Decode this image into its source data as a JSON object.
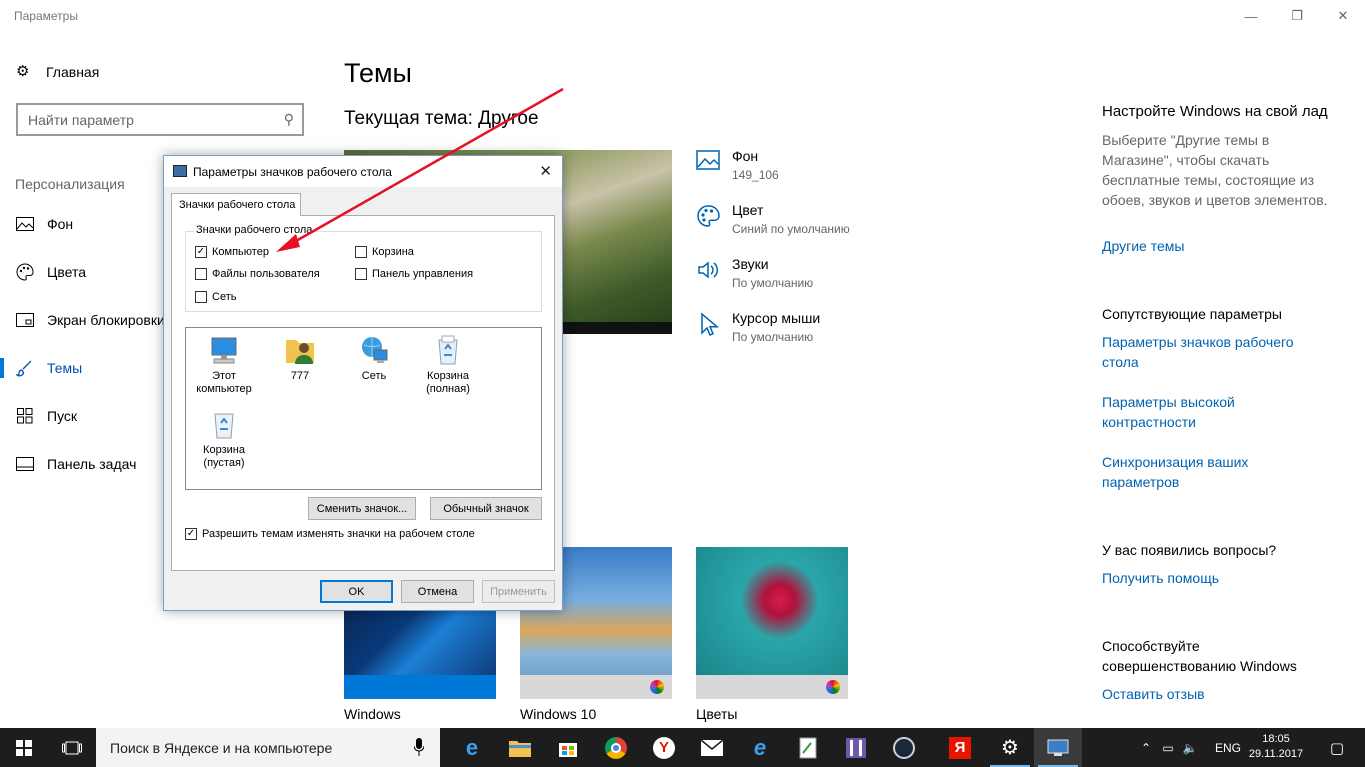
{
  "window": {
    "title": "Параметры"
  },
  "sidebar": {
    "home": "Главная",
    "search_placeholder": "Найти параметр",
    "section": "Персонализация",
    "items": [
      {
        "label": "Фон",
        "icon": "picture-icon"
      },
      {
        "label": "Цвета",
        "icon": "palette-icon"
      },
      {
        "label": "Экран блокировки",
        "icon": "lock-screen-icon"
      },
      {
        "label": "Темы",
        "icon": "brush-icon",
        "active": true
      },
      {
        "label": "Пуск",
        "icon": "start-icon"
      },
      {
        "label": "Панель задач",
        "icon": "taskbar-icon"
      }
    ]
  },
  "main": {
    "title": "Темы",
    "current_theme": "Текущая тема: Другое",
    "props": [
      {
        "title": "Фон",
        "value": "149_106",
        "icon": "picture-icon"
      },
      {
        "title": "Цвет",
        "value": "Синий по умолчанию",
        "icon": "palette-icon"
      },
      {
        "title": "Звуки",
        "value": "По умолчанию",
        "icon": "speaker-icon"
      },
      {
        "title": "Курсор мыши",
        "value": "По умолчанию",
        "icon": "cursor-icon"
      }
    ],
    "themes": [
      {
        "name": "Windows"
      },
      {
        "name": "Windows 10"
      },
      {
        "name": "Цветы"
      }
    ]
  },
  "right": {
    "h1": "Настройте Windows на свой лад",
    "p1": "Выберите \"Другие темы в Магазине\", чтобы скачать бесплатные темы, состоящие из обоев, звуков и цветов элементов.",
    "link1": "Другие темы",
    "h2": "Сопутствующие параметры",
    "link2": "Параметры значков рабочего стола",
    "link3": "Параметры высокой контрастности",
    "link4": "Синхронизация ваших параметров",
    "h3": "У вас появились вопросы?",
    "link5": "Получить помощь",
    "h4": "Способствуйте совершенствованию Windows",
    "link6": "Оставить отзыв"
  },
  "dialog": {
    "title": "Параметры значков рабочего стола",
    "tab": "Значки рабочего стола",
    "group": "Значки рабочего стола",
    "checkboxes": [
      {
        "label": "Компьютер",
        "checked": true
      },
      {
        "label": "Корзина",
        "checked": false
      },
      {
        "label": "Файлы пользователя",
        "checked": false
      },
      {
        "label": "Панель управления",
        "checked": false
      },
      {
        "label": "Сеть",
        "checked": false
      }
    ],
    "icons": [
      {
        "label": "Этот компьютер",
        "icon": "computer-icon"
      },
      {
        "label": "777",
        "icon": "user-folder-icon"
      },
      {
        "label": "Сеть",
        "icon": "network-icon"
      },
      {
        "label": "Корзина (полная)",
        "icon": "recycle-bin-full-icon"
      },
      {
        "label": "Корзина (пустая)",
        "icon": "recycle-bin-empty-icon"
      }
    ],
    "change_icon": "Сменить значок...",
    "default_icon": "Обычный значок",
    "allow_themes": "Разрешить темам изменять значки на рабочем столе",
    "allow_themes_checked": true,
    "ok": "OK",
    "cancel": "Отмена",
    "apply": "Применить"
  },
  "taskbar": {
    "search_placeholder": "Поиск в Яндексе и на компьютере",
    "lang": "ENG",
    "time": "18:05",
    "date": "29.11.2017"
  },
  "colors": {
    "accent": "#0078d7",
    "link": "#0063b1",
    "arrow": "#e81123"
  }
}
